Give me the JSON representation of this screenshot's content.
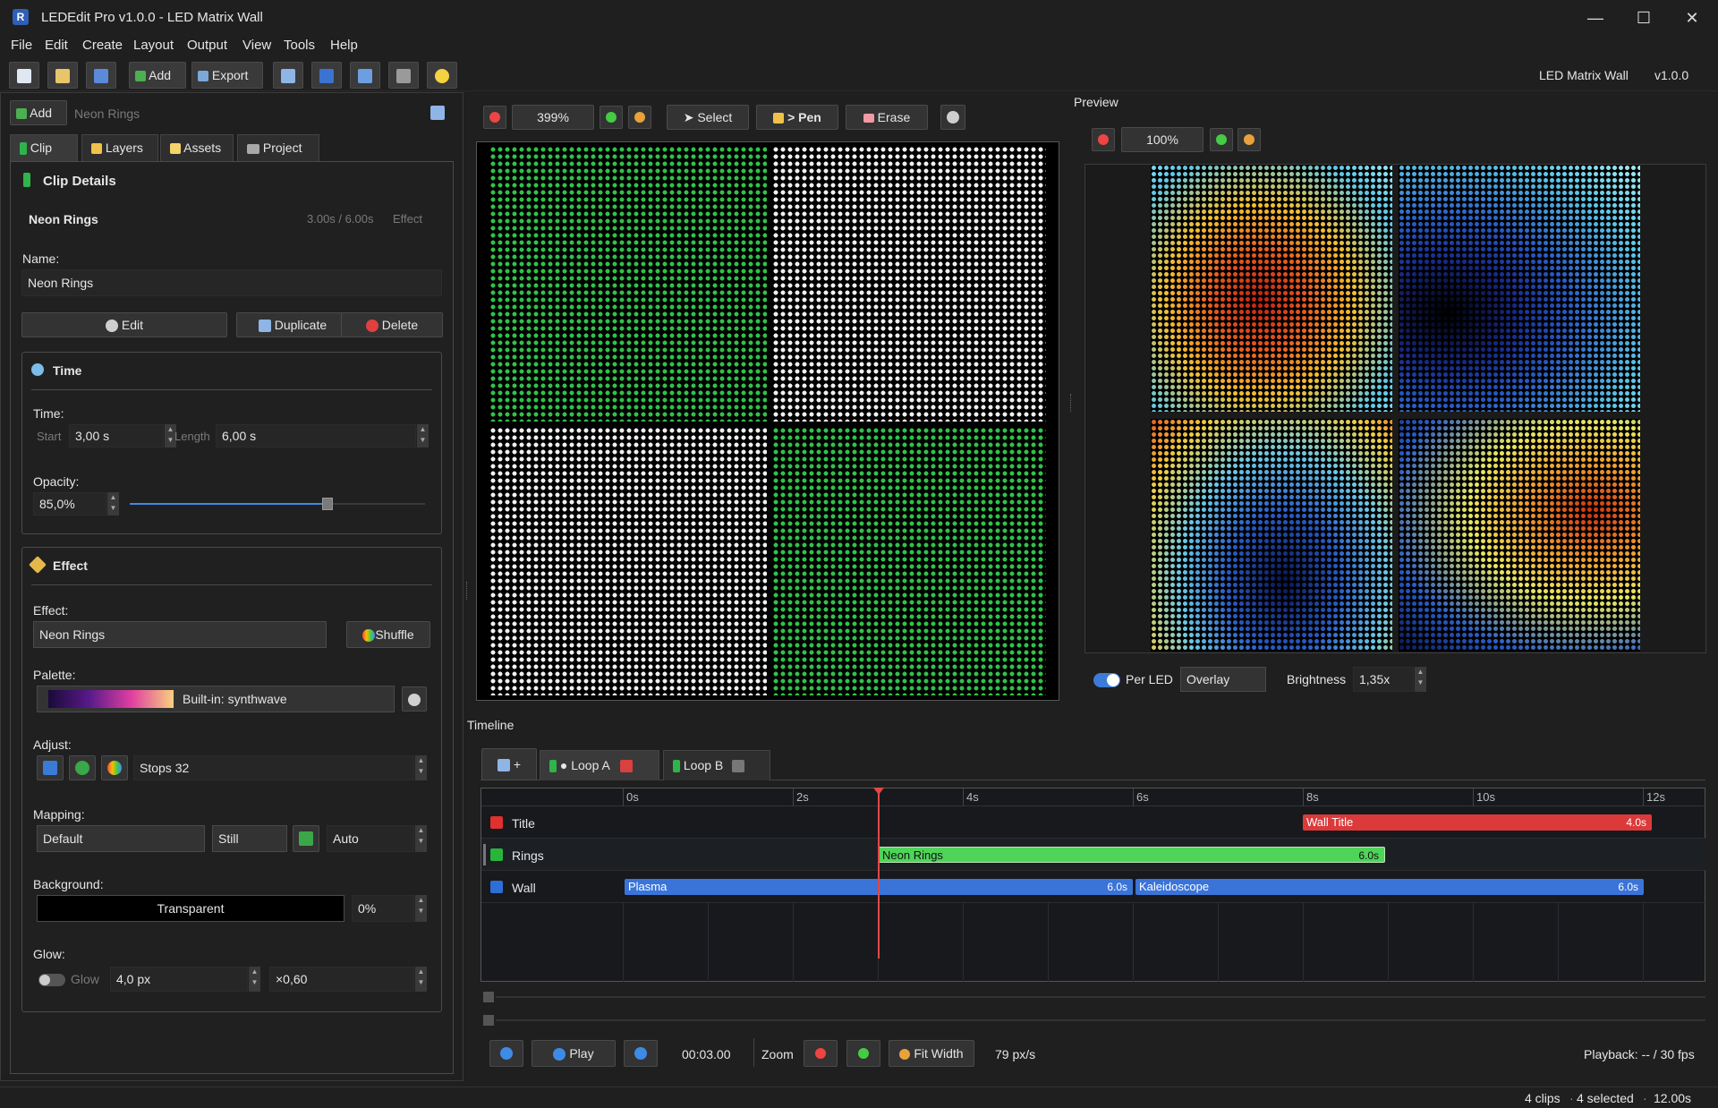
{
  "window": {
    "title": "LEDEdit Pro v1.0.0 - LED Matrix Wall",
    "min": "—",
    "max": "☐",
    "close": "✕"
  },
  "menu": [
    "File",
    "Edit",
    "Create",
    "Layout",
    "Output",
    "View",
    "Tools",
    "Help"
  ],
  "toolbar": {
    "add": "Add",
    "export": "Export",
    "project_name": "LED Matrix Wall",
    "version": "v1.0.0"
  },
  "left": {
    "add_button": "Add",
    "clip_name_hint": "Neon Rings",
    "tabs": [
      "Clip",
      "Layers",
      "Assets",
      "Project"
    ],
    "section_title": "Clip Details",
    "clip_title": "Neon Rings",
    "clip_time": "3.00s / 6.00s",
    "clip_type": "Effect",
    "name_label": "Name:",
    "name_value": "Neon Rings",
    "edit": "Edit",
    "duplicate": "Duplicate",
    "delete": "Delete",
    "time_group": "Time",
    "time_label": "Time:",
    "start_label": "Start",
    "start_value": "3,00 s",
    "length_label": "Length",
    "length_value": "6,00 s",
    "opacity_label": "Opacity:",
    "opacity_value": "85,0%",
    "opacity_fraction": 0.85,
    "effect_group": "Effect",
    "effect_label": "Effect:",
    "effect_value": "Neon Rings",
    "shuffle": "Shuffle",
    "palette_label": "Palette:",
    "palette_value": "Built-in: synthwave",
    "adjust_label": "Adjust:",
    "stops_value": "Stops 32",
    "mapping_label": "Mapping:",
    "mapping_value": "Default",
    "still_value": "Still",
    "auto_value": "Auto",
    "background_label": "Background:",
    "background_value": "Transparent",
    "background_pct": "0%",
    "glow_label": "Glow:",
    "glow_toggle": "Glow",
    "glow_px": "4,0 px",
    "glow_mult": "×0,60"
  },
  "editor": {
    "zoom": "399%",
    "select": "Select",
    "pen": "> Pen",
    "erase": "Erase"
  },
  "preview": {
    "title": "Preview",
    "zoom": "100%",
    "per_led": "Per LED",
    "overlay": "Overlay",
    "brightness_label": "Brightness",
    "brightness_value": "1,35x"
  },
  "timeline": {
    "title": "Timeline",
    "add": "+",
    "tabs": [
      {
        "label": "● Loop A"
      },
      {
        "label": "Loop B"
      }
    ],
    "ticks": [
      "0s",
      "2s",
      "4s",
      "6s",
      "8s",
      "10s",
      "12s"
    ],
    "tracks": [
      {
        "name": "Title",
        "color": "#e0312e"
      },
      {
        "name": "Rings",
        "color": "#27b53c"
      },
      {
        "name": "Wall",
        "color": "#2d6fd6"
      }
    ],
    "clips": [
      {
        "label": "Wall Title",
        "dur": "4.0s"
      },
      {
        "label": "Neon Rings",
        "dur": "6.0s"
      },
      {
        "label": "Plasma",
        "dur": "6.0s"
      },
      {
        "label": "Kaleidoscope",
        "dur": "6.0s"
      }
    ],
    "play": "Play",
    "timecode": "00:03.00",
    "zoom_label": "Zoom",
    "fit_width": "Fit Width",
    "px_per_s": "79 px/s",
    "playback": "Playback: -- / 30 fps"
  },
  "status": {
    "clips": "4 clips",
    "selected": "4 selected",
    "length": "12.00s"
  }
}
